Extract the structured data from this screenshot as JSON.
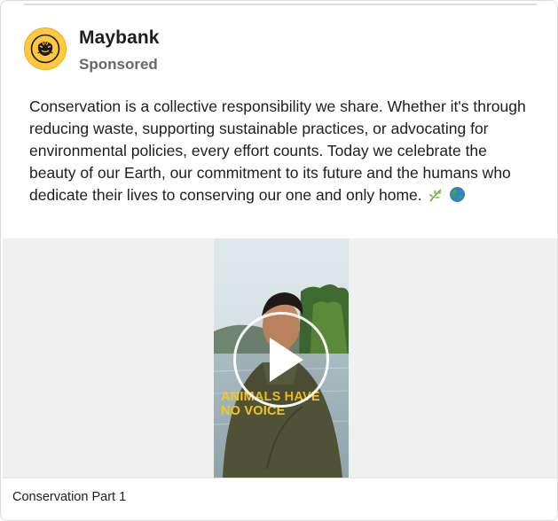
{
  "post": {
    "brand_name": "Maybank",
    "sponsored_label": "Sponsored",
    "text": "Conservation is a collective responsibility we share. Whether it's through reducing waste, supporting sustainable practices, or advocating for environmental policies, every effort counts. Today we celebrate the beauty of our Earth, our commitment to its future and the humans who dedicate their lives to conserving our one and only home.",
    "emojis": [
      "herb-icon",
      "globe-icon"
    ]
  },
  "video": {
    "overlay_line1": "ANIMALS HAVE",
    "overlay_line2": "NO VOICE",
    "play_icon": "play-icon"
  },
  "caption": "Conservation Part 1",
  "colors": {
    "brand_yellow": "#ffc83d",
    "overlay_yellow": "#f7c51e",
    "text_primary": "#1c1e21",
    "text_secondary": "#65676b"
  }
}
